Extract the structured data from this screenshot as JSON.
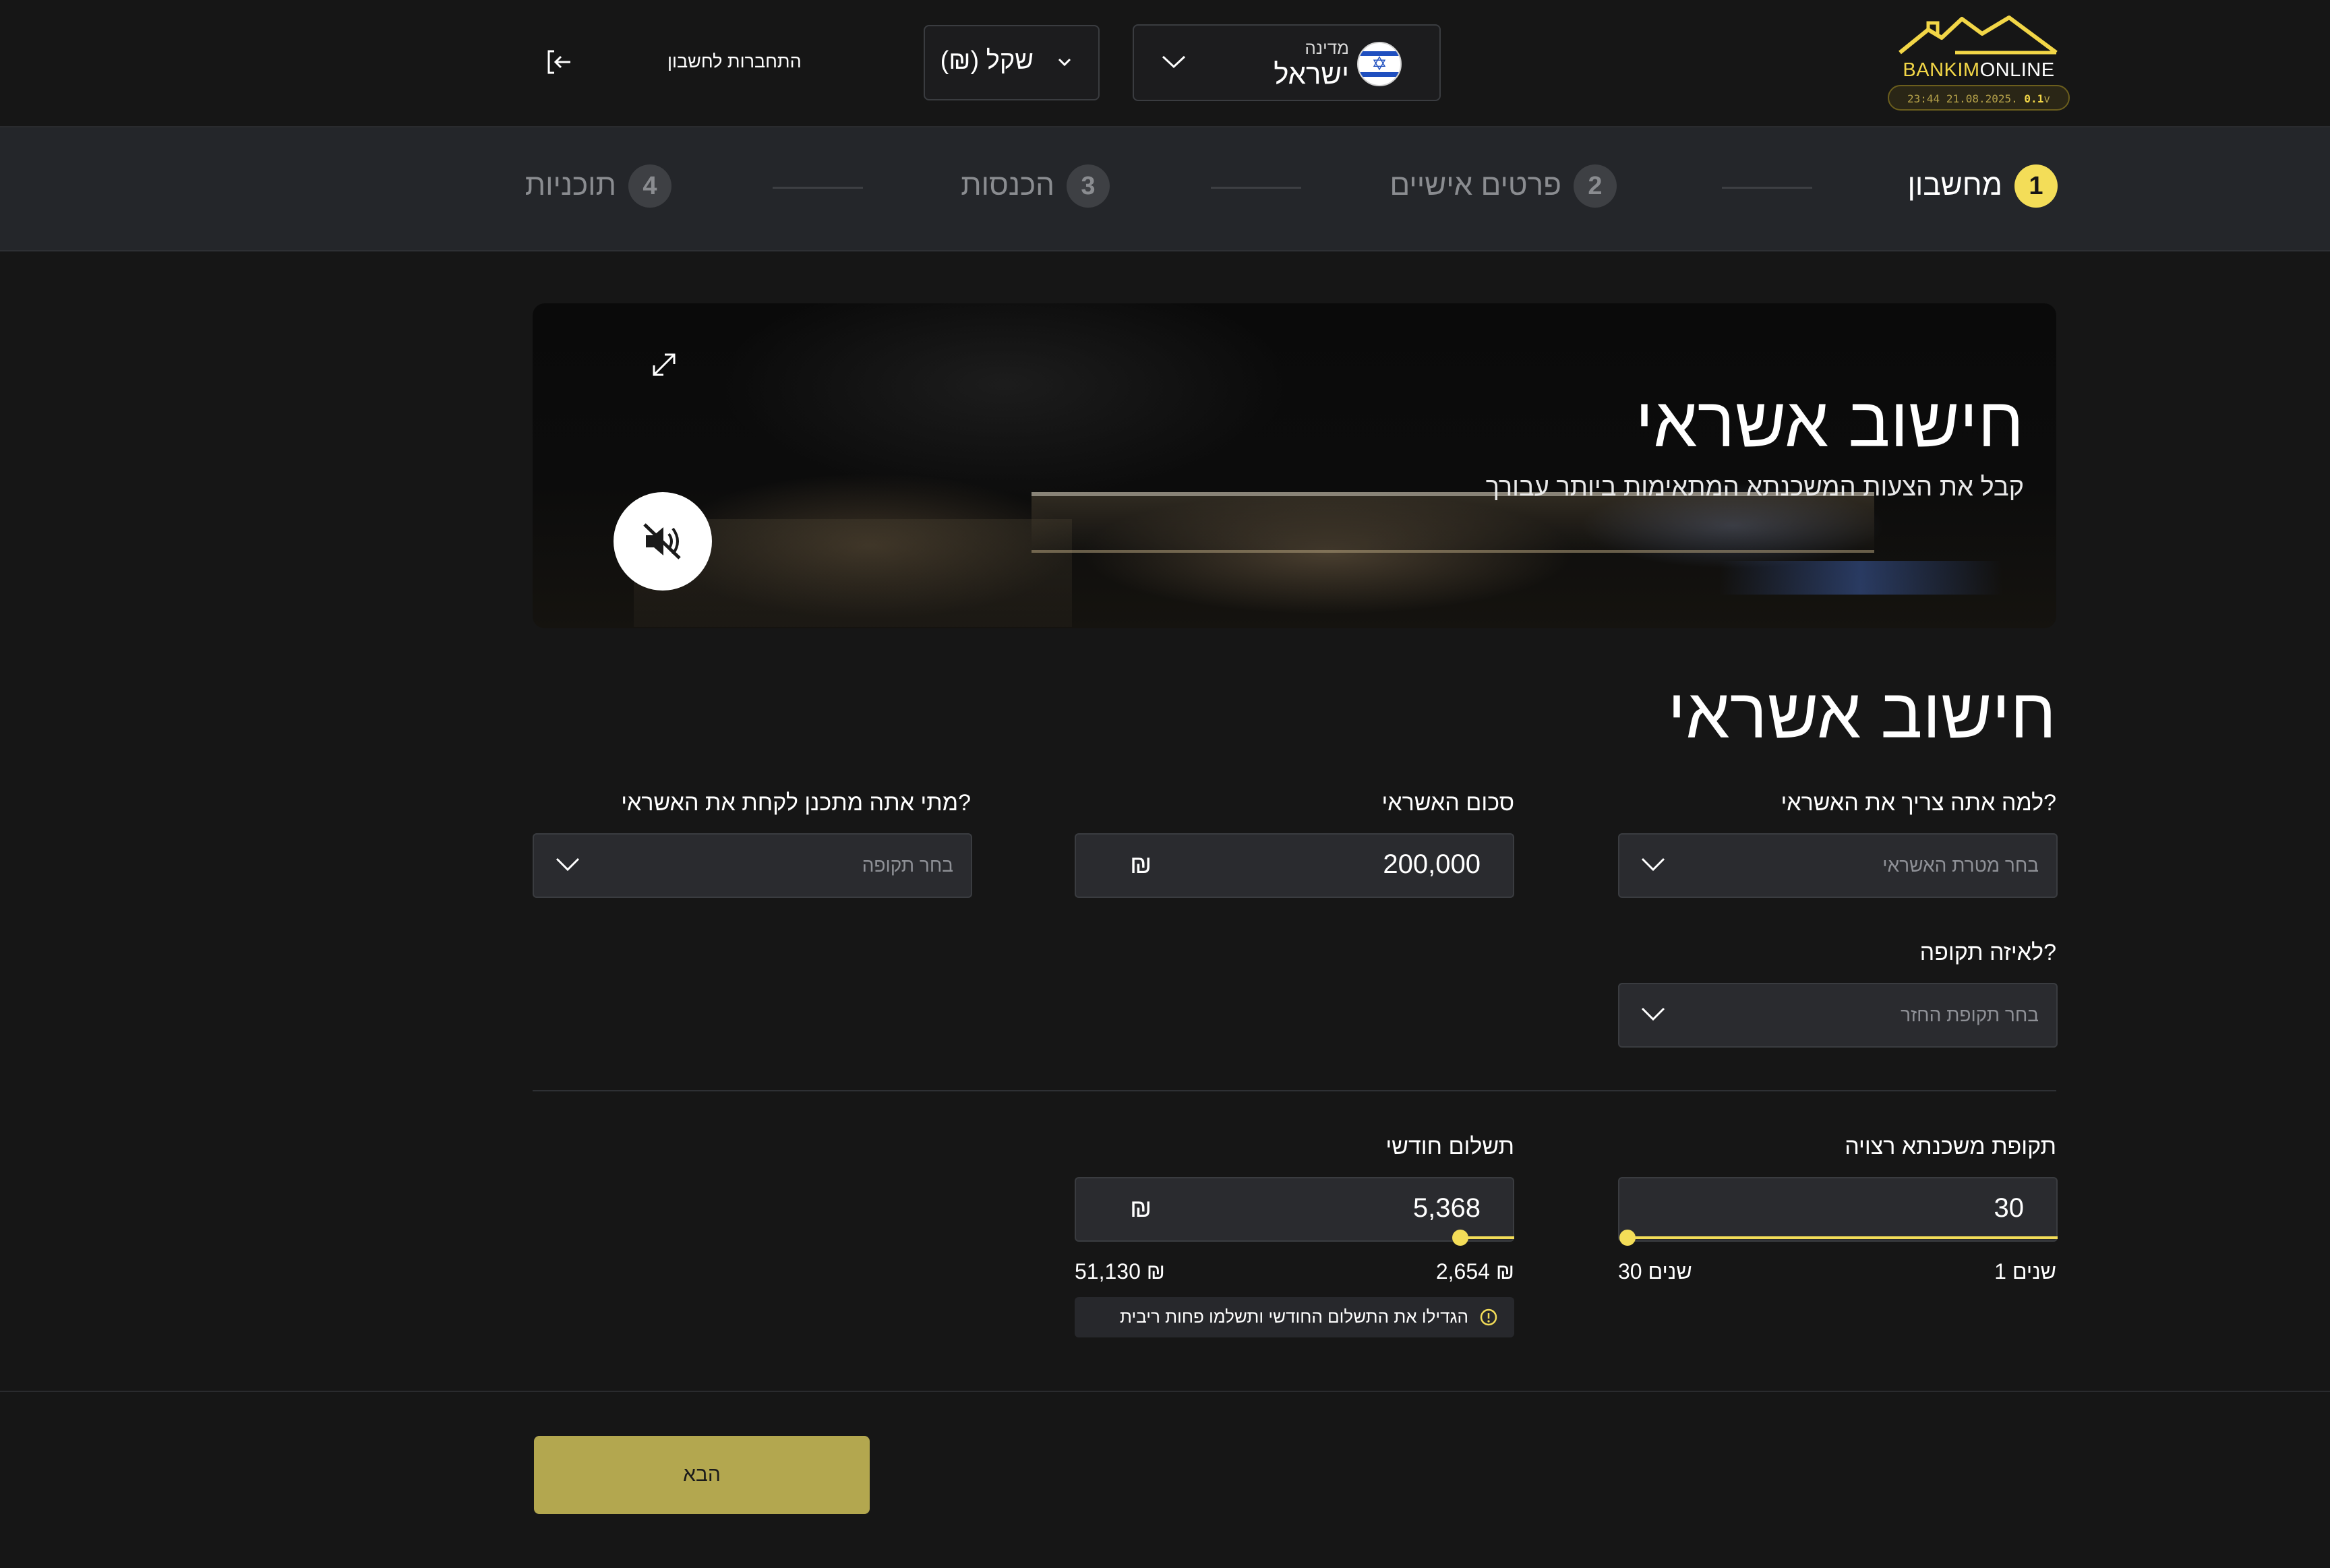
{
  "header": {
    "logo_text_bold": "BANKIM",
    "logo_text": "ONLINE",
    "version_time": "23:44 21.08.2025.",
    "version_num": "0.1",
    "version_suffix": "v",
    "country_caption": "מדינה",
    "country_value": "ישראל",
    "currency_value": "(₪) שקל",
    "login_label": "התחברות לחשבון"
  },
  "steps": [
    {
      "number": "1",
      "label": "מחשבון",
      "active": true
    },
    {
      "number": "2",
      "label": "פרטים אישיים",
      "active": false
    },
    {
      "number": "3",
      "label": "הכנסות",
      "active": false
    },
    {
      "number": "4",
      "label": "תוכניות",
      "active": false
    }
  ],
  "banner": {
    "title": "חישוב אשראי",
    "subtitle": "קבל את הצעות המשכנתא המתאימות ביותר עבורך"
  },
  "form": {
    "title": "חישוב אשראי",
    "purpose": {
      "label": "למה אתה צריך את האשראי?",
      "placeholder": "בחר מטרת האשראי"
    },
    "amount": {
      "label": "סכום האשראי",
      "value": "200,000",
      "currency": "₪"
    },
    "when": {
      "label": "מתי אתה מתכנן לקחת את האשראי?",
      "placeholder": "בחר תקופה"
    },
    "period": {
      "label": "לאיזה תקופה?",
      "placeholder": "בחר תקופת החזר"
    },
    "term": {
      "label": "תקופת משכנתא רצויה",
      "value": "30",
      "min_label": "1 שנים",
      "max_label": "30 שנים",
      "level": 1.0
    },
    "monthly": {
      "label": "תשלום חודשי",
      "value": "5,368",
      "currency": "₪",
      "min_label": "2,654 ₪",
      "max_label": "51,130 ₪",
      "level": 0.06
    },
    "tip": "הגדילו את התשלום החודשי ותשלמו פחות ריבית"
  },
  "footer": {
    "next_label": "הבא"
  },
  "colors": {
    "accent": "#f3dd58",
    "button": "#b3a74f",
    "background": "#161616",
    "panel": "#24262a",
    "field": "#2a2b2f"
  },
  "icons": [
    "logo-house-icon",
    "israel-flag-icon",
    "chevron-down-icon",
    "login-arrow-icon",
    "expand-icon",
    "mute-icon",
    "info-icon"
  ]
}
